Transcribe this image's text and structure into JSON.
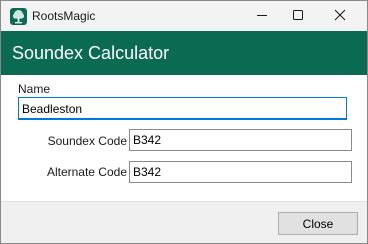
{
  "window": {
    "app_title": "RootsMagic",
    "app_icon": "tree-icon",
    "controls": [
      "minimize-icon",
      "maximize-icon",
      "close-icon"
    ]
  },
  "dialog": {
    "title": "Soundex Calculator",
    "header_color": "#0a6a52"
  },
  "form": {
    "name_label": "Name",
    "name_value": "Beadleston",
    "soundex_label": "Soundex Code",
    "soundex_value": "B342",
    "alternate_label": "Alternate Code",
    "alternate_value": "B342"
  },
  "footer": {
    "close_label": "Close"
  }
}
